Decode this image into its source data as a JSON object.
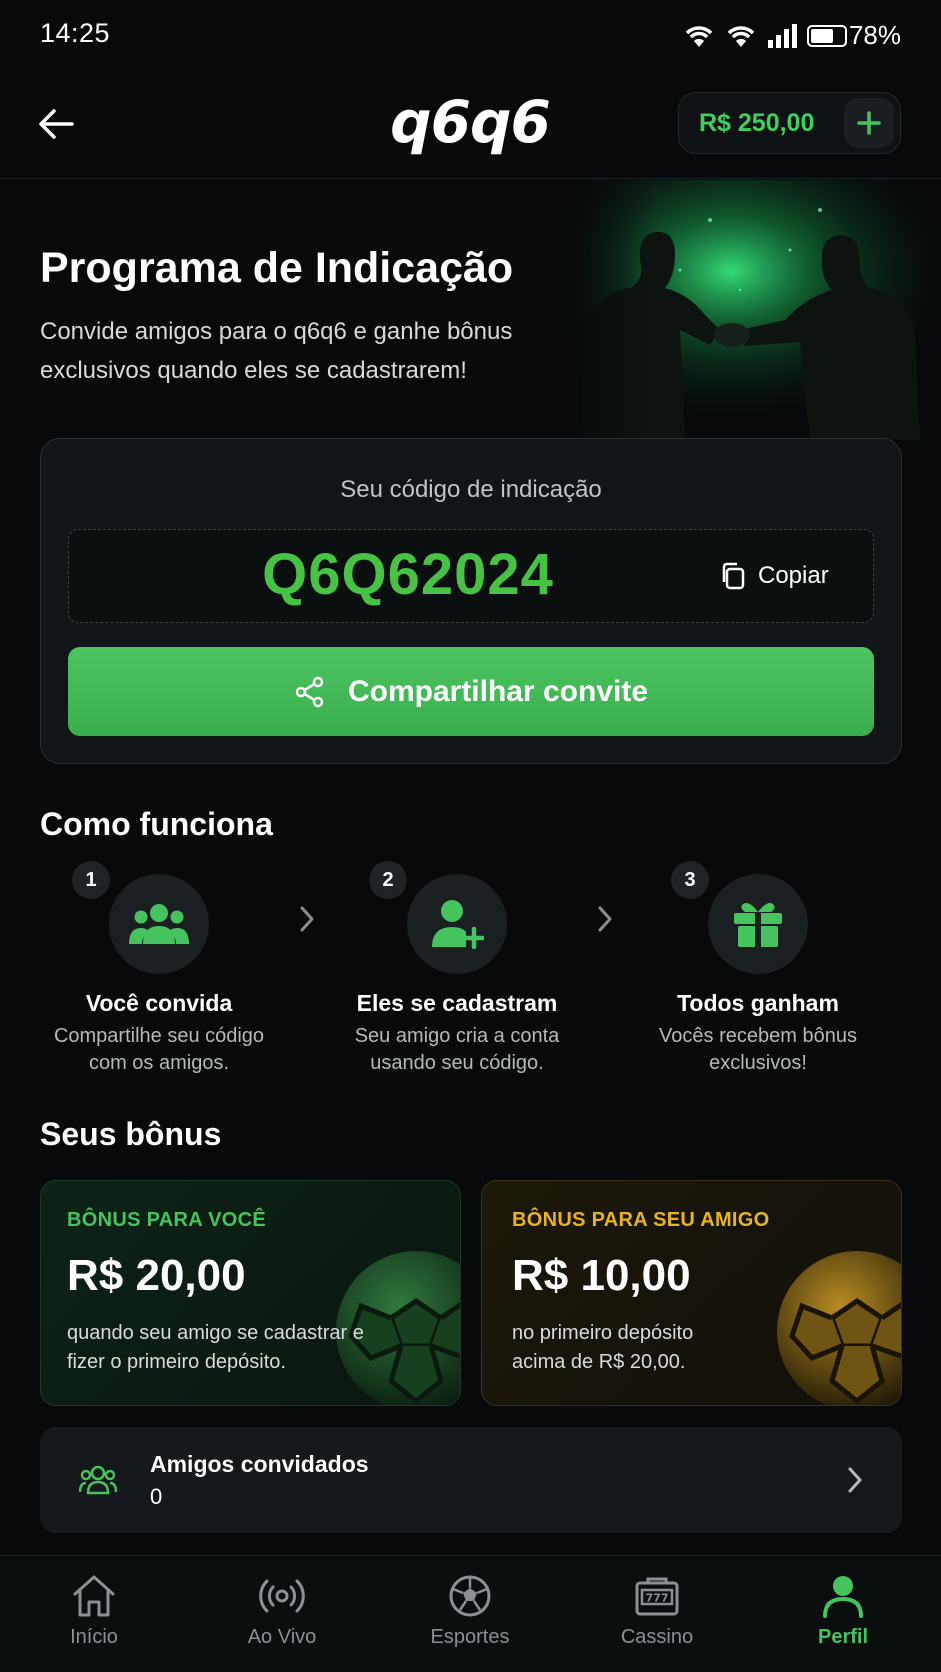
{
  "status_bar": {
    "time": "14:25",
    "battery": "78%"
  },
  "header": {
    "logo": "q6q6",
    "balance": "R$ 250,00"
  },
  "hero": {
    "title": "Programa de Indicação",
    "subtitle": "Convide amigos para o q6q6 e ganhe bônus exclusivos quando eles se cadastrarem!"
  },
  "referral": {
    "label": "Seu código de indicação",
    "code": "Q6Q62024",
    "copy_label": "Copiar",
    "share_label": "Compartilhar convite"
  },
  "how_it_works": {
    "title": "Como funciona",
    "steps": [
      {
        "num": "1",
        "title": "Você convida",
        "desc": "Compartilhe seu código com os amigos.",
        "icon": "group-icon"
      },
      {
        "num": "2",
        "title": "Eles se cadastram",
        "desc": "Seu amigo cria a conta usando seu código.",
        "icon": "user-plus-icon"
      },
      {
        "num": "3",
        "title": "Todos ganham",
        "desc": "Vocês recebem bônus exclusivos!",
        "icon": "gift-icon"
      }
    ]
  },
  "bonuses": {
    "title": "Seus bônus",
    "cards": [
      {
        "label": "BÔNUS PARA VOCÊ",
        "value": "R$ 20,00",
        "desc": "quando seu amigo se cadastrar e fizer o primeiro depósito.",
        "accent": "#46c35e"
      },
      {
        "label": "BÔNUS PARA SEU AMIGO",
        "value": "R$ 10,00",
        "desc": "no primeiro depósito acima de R$ 20,00.",
        "accent": "#e6b422"
      }
    ]
  },
  "friends": {
    "title": "Amigos convidados",
    "count": "0"
  },
  "nav": {
    "items": [
      {
        "label": "Início",
        "icon": "home-icon"
      },
      {
        "label": "Ao Vivo",
        "icon": "live-icon"
      },
      {
        "label": "Esportes",
        "icon": "soccer-ball-icon"
      },
      {
        "label": "Cassino",
        "icon": "slot-machine-icon"
      },
      {
        "label": "Perfil",
        "icon": "user-icon",
        "active": true
      }
    ]
  },
  "colors": {
    "accent": "#46c35e",
    "gold": "#e6b422",
    "background": "#07090a"
  }
}
